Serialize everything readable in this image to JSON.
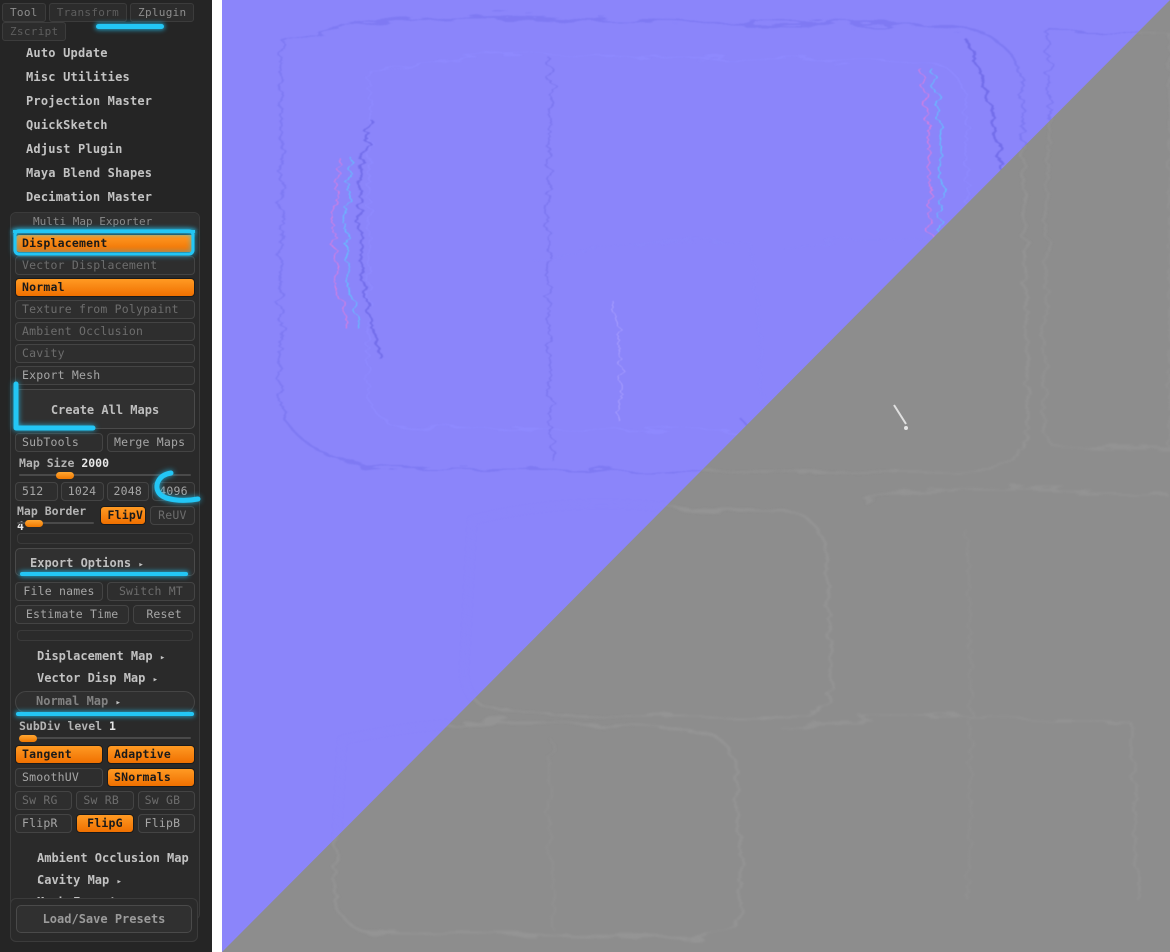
{
  "menubar": {
    "tabs": [
      {
        "label": "Tool",
        "active": false
      },
      {
        "label": "Transform",
        "active": false
      },
      {
        "label": "Zplugin",
        "active": true
      },
      {
        "label": "Zscript",
        "active": false
      }
    ]
  },
  "plugins": [
    {
      "label": "Auto Update"
    },
    {
      "label": "Misc Utilities"
    },
    {
      "label": "Projection Master"
    },
    {
      "label": "QuickSketch"
    },
    {
      "label": "Adjust Plugin"
    },
    {
      "label": "Maya Blend Shapes"
    },
    {
      "label": "Decimation Master"
    }
  ],
  "multi_map_exporter": {
    "title": "Multi Map Exporter",
    "map_types": [
      {
        "label": "Displacement",
        "on": true
      },
      {
        "label": "Vector Displacement",
        "on": false
      },
      {
        "label": "Normal",
        "on": true
      },
      {
        "label": "Texture from Polypaint",
        "on": false
      },
      {
        "label": "Ambient Occlusion",
        "on": false
      },
      {
        "label": "Cavity",
        "on": false
      },
      {
        "label": "Export Mesh",
        "on": false
      }
    ],
    "create_all_maps": "Create All Maps",
    "subtools_label": "SubTools",
    "merge_maps_label": "Merge Maps",
    "map_size_label": "Map Size",
    "map_size_value": "2000",
    "map_size_percent": 27,
    "size_presets": [
      {
        "label": "512",
        "on": false
      },
      {
        "label": "1024",
        "on": false
      },
      {
        "label": "2048",
        "on": false
      },
      {
        "label": "4096",
        "on": false
      }
    ],
    "map_border_label": "Map Border",
    "map_border_value": "4",
    "map_border_percent": 22,
    "flipv_label": "FlipV",
    "flipv_on": true,
    "reuv_label": "ReUV",
    "reuv_on": false,
    "export_options_label": "Export Options",
    "file_names_label": "File names",
    "switch_mt_label": "Switch MT",
    "estimate_time_label": "Estimate Time",
    "reset_label": "Reset",
    "sections": [
      {
        "label": "Displacement Map",
        "expanded": false
      },
      {
        "label": "Vector Disp Map",
        "expanded": false
      },
      {
        "label": "Normal Map",
        "expanded": true
      }
    ],
    "normal_map": {
      "subdiv_label": "SubDiv level",
      "subdiv_value": "1",
      "subdiv_percent": 5,
      "tangent": {
        "label": "Tangent",
        "on": true
      },
      "adaptive": {
        "label": "Adaptive",
        "on": true
      },
      "smoothuv": {
        "label": "SmoothUV",
        "on": false
      },
      "snormals": {
        "label": "SNormals",
        "on": true
      },
      "sw_rg": {
        "label": "Sw RG",
        "on": false
      },
      "sw_rb": {
        "label": "Sw RB",
        "on": false
      },
      "sw_gb": {
        "label": "Sw GB",
        "on": false
      },
      "flipr": {
        "label": "FlipR",
        "on": false
      },
      "flipg": {
        "label": "FlipG",
        "on": true
      },
      "flipb": {
        "label": "FlipB",
        "on": false
      }
    },
    "tail_sections": [
      {
        "label": "Ambient Occlusion Map"
      },
      {
        "label": "Cavity Map"
      },
      {
        "label": "Mesh Export"
      }
    ],
    "presets_label": "Load/Save Presets"
  },
  "canvas": {
    "normal_map_color": "#8b85fa",
    "displacement_map_color": "#8d8d8d",
    "split": "diagonal-top-right-to-bottom-left"
  },
  "annotations": {
    "accent_color": "#23c6f5",
    "marks": [
      {
        "name": "zplugin-tab-underline",
        "target": "Zplugin"
      },
      {
        "name": "multi-map-exporter-underline",
        "target": "Multi Map Exporter"
      },
      {
        "name": "displacement-outline",
        "target": "Displacement"
      },
      {
        "name": "create-all-maps-bracket",
        "target": "Create All Maps"
      },
      {
        "name": "map-size-4096-circle",
        "target": "4096"
      },
      {
        "name": "export-options-underline",
        "target": "Export Options"
      },
      {
        "name": "normal-map-underline",
        "target": "Normal Map"
      }
    ]
  }
}
